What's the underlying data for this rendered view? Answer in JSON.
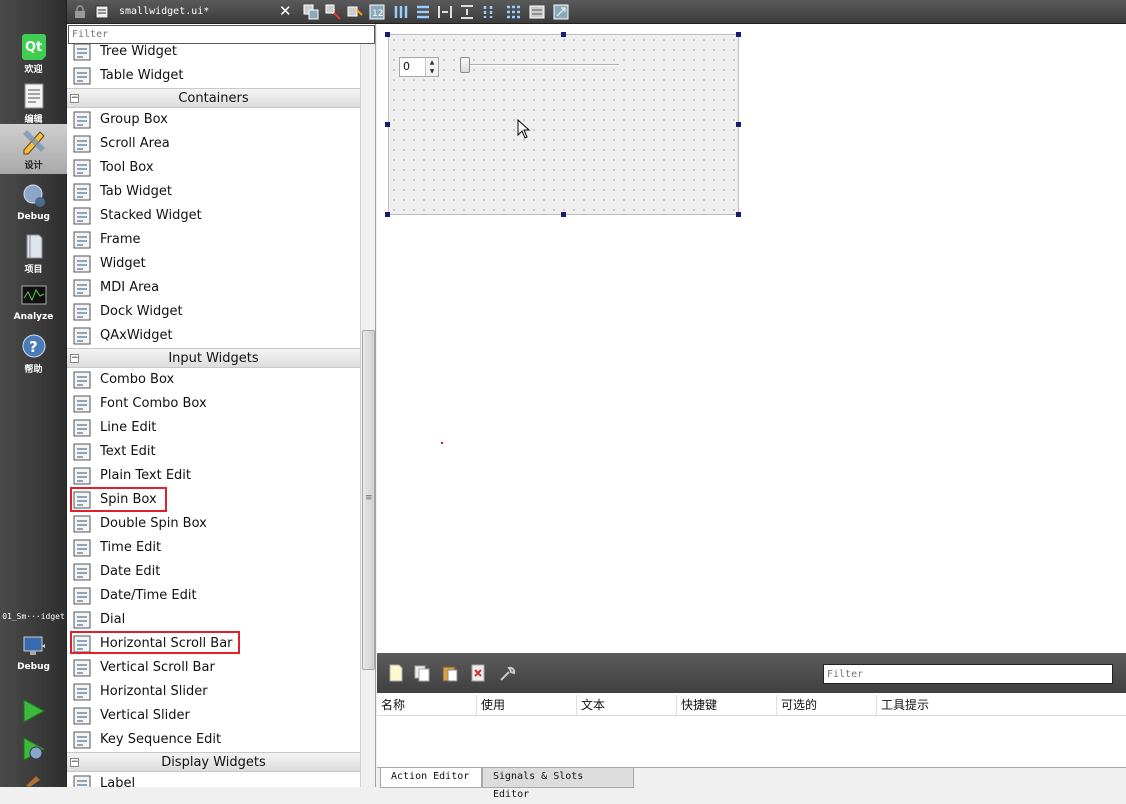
{
  "modebar": {
    "modes": [
      {
        "name": "welcome",
        "label": "欢迎"
      },
      {
        "name": "edit",
        "label": "编辑"
      },
      {
        "name": "design",
        "label": "设计"
      },
      {
        "name": "debug",
        "label": "Debug"
      },
      {
        "name": "projects",
        "label": "项目"
      },
      {
        "name": "analyze",
        "label": "Analyze"
      },
      {
        "name": "help",
        "label": "帮助"
      }
    ],
    "session_label": "01_Sm···idget",
    "build_target_label": "Debug"
  },
  "toolbar": {
    "file_name": "smallwidget.ui*"
  },
  "widget_box": {
    "filter_placeholder": "Filter",
    "items": [
      {
        "kind": "item",
        "label": "Tree Widget",
        "icon": "tree-icon"
      },
      {
        "kind": "item",
        "label": "Table Widget",
        "icon": "table-icon"
      },
      {
        "kind": "category",
        "label": "Containers"
      },
      {
        "kind": "item",
        "label": "Group Box",
        "icon": "groupbox-icon"
      },
      {
        "kind": "item",
        "label": "Scroll Area",
        "icon": "scrollarea-icon"
      },
      {
        "kind": "item",
        "label": "Tool Box",
        "icon": "toolbox-icon"
      },
      {
        "kind": "item",
        "label": "Tab Widget",
        "icon": "tabwidget-icon"
      },
      {
        "kind": "item",
        "label": "Stacked Widget",
        "icon": "stacked-icon"
      },
      {
        "kind": "item",
        "label": "Frame",
        "icon": "frame-icon"
      },
      {
        "kind": "item",
        "label": "Widget",
        "icon": "widget-icon"
      },
      {
        "kind": "item",
        "label": "MDI Area",
        "icon": "mdi-icon"
      },
      {
        "kind": "item",
        "label": "Dock Widget",
        "icon": "dock-icon"
      },
      {
        "kind": "item",
        "label": "QAxWidget",
        "icon": "qax-icon"
      },
      {
        "kind": "category",
        "label": "Input Widgets"
      },
      {
        "kind": "item",
        "label": "Combo Box",
        "icon": "combobox-icon"
      },
      {
        "kind": "item",
        "label": "Font Combo Box",
        "icon": "fontcombo-icon"
      },
      {
        "kind": "item",
        "label": "Line Edit",
        "icon": "lineedit-icon"
      },
      {
        "kind": "item",
        "label": "Text Edit",
        "icon": "textedit-icon"
      },
      {
        "kind": "item",
        "label": "Plain Text Edit",
        "icon": "plaintext-icon"
      },
      {
        "kind": "item",
        "label": "Spin Box",
        "icon": "spinbox-icon",
        "highlighted": true
      },
      {
        "kind": "item",
        "label": "Double Spin Box",
        "icon": "doublespin-icon"
      },
      {
        "kind": "item",
        "label": "Time Edit",
        "icon": "clock-icon"
      },
      {
        "kind": "item",
        "label": "Date Edit",
        "icon": "calendar-icon"
      },
      {
        "kind": "item",
        "label": "Date/Time Edit",
        "icon": "datetime-icon"
      },
      {
        "kind": "item",
        "label": "Dial",
        "icon": "dial-icon"
      },
      {
        "kind": "item",
        "label": "Horizontal Scroll Bar",
        "icon": "hscrollbar-icon",
        "highlighted": true
      },
      {
        "kind": "item",
        "label": "Vertical Scroll Bar",
        "icon": "vscrollbar-icon"
      },
      {
        "kind": "item",
        "label": "Horizontal Slider",
        "icon": "hslider-icon"
      },
      {
        "kind": "item",
        "label": "Vertical Slider",
        "icon": "vslider-icon"
      },
      {
        "kind": "item",
        "label": "Key Sequence Edit",
        "icon": "keyseq-icon"
      },
      {
        "kind": "category",
        "label": "Display Widgets"
      },
      {
        "kind": "item",
        "label": "Label",
        "icon": "label-icon"
      }
    ]
  },
  "form": {
    "spinbox_value": "0"
  },
  "action_editor": {
    "filter_placeholder": "Filter",
    "columns": [
      "名称",
      "使用",
      "文本",
      "快捷键",
      "可选的",
      "工具提示"
    ],
    "tabs": [
      {
        "label": "Action Editor",
        "active": true
      },
      {
        "label": "Signals & Slots Editor",
        "active": false
      }
    ]
  }
}
